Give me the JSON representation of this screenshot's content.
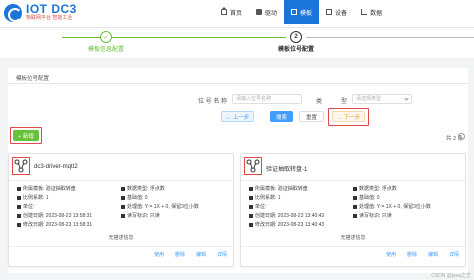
{
  "header": {
    "logo_title": "IOT DC3",
    "logo_slogan": "物联网平台  智能工业",
    "nav": [
      {
        "label": "首页",
        "icon": "home-icon",
        "active": false
      },
      {
        "label": "驱动",
        "icon": "driver-icon",
        "active": false
      },
      {
        "label": "模板",
        "icon": "template-icon",
        "active": true
      },
      {
        "label": "设备",
        "icon": "device-icon",
        "active": false
      },
      {
        "label": "数据",
        "icon": "data-icon",
        "active": false
      }
    ]
  },
  "steps": [
    {
      "number": "✓",
      "label": "模板信息配置",
      "status": "done"
    },
    {
      "number": "2",
      "label": "模板位号配置",
      "status": "current"
    }
  ],
  "panel": {
    "title": "模板位号配置",
    "filters": {
      "name_label": "位  号  名  称",
      "name_placeholder": "请输入位号名称",
      "type_label": "类",
      "type_label2": "型",
      "type_placeholder": "请选择类型"
    },
    "buttons": {
      "prev": "← 上一步",
      "search": "搜索",
      "reset": "重置",
      "next": "→ 下一步",
      "add": "+ 新增"
    },
    "total": "共 2 条"
  },
  "cards": [
    {
      "name": "dc3-driver-mqtt2",
      "profile": "所属模板: 验证抽取转盘",
      "data_type": "数据类型: 浮点数",
      "scale": "比例系数: 1",
      "base": "基础值: 0",
      "unit": "单位:",
      "process": "处理值: Y = 1X + 0, 保留3位小数",
      "created": "创建日期: 2023-08-23 13:58:31",
      "rw": "读写标识: 只读",
      "updated": "修改日期: 2023-08-23 13:58:31",
      "description": "无描述信息",
      "actions": [
        "使用",
        "删除",
        "编辑",
        "详情"
      ]
    },
    {
      "name": "验证抽取转盘-1",
      "profile": "所属模板: 验证抽取转盘",
      "data_type": "数据类型: 浮点数",
      "scale": "比例系数: 1",
      "base": "基础值: 0",
      "unit": "单位:",
      "process": "处理值: Y = 1X + 0, 保留3位小数",
      "created": "创建日期: 2023-08-23 13:40:43",
      "rw": "读写标识: 只读",
      "updated": "修改日期: 2023-08-23 13:40:43",
      "description": "无描述信息",
      "actions": [
        "使用",
        "删除",
        "编辑",
        "详情"
      ]
    }
  ],
  "watermark": "CSDN @java之艺",
  "colors": {
    "primary": "#1b74d8",
    "success": "#67c23a",
    "warning": "#e6a23c",
    "highlight": "#e24a4a"
  }
}
